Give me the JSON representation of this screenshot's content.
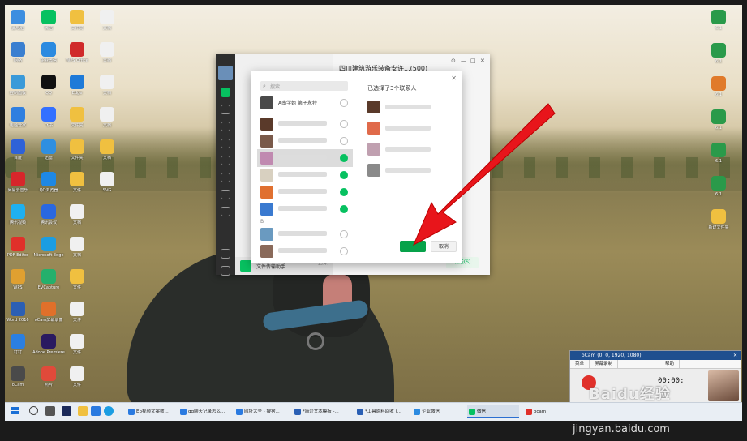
{
  "desktop": {
    "left_col1": [
      {
        "label": "此电脑",
        "color": "#3d8ee0"
      },
      {
        "label": "网络",
        "color": "#3a7fd0"
      },
      {
        "label": "控制面板",
        "color": "#3a9ad9"
      },
      {
        "label": "电脑管家",
        "color": "#2f7fe0"
      },
      {
        "label": "百度",
        "color": "#2f62d8"
      },
      {
        "label": "网易云音乐",
        "color": "#d7262b"
      },
      {
        "label": "腾讯视频",
        "color": "#1fb0f0"
      },
      {
        "label": "PDF Editor",
        "color": "#e0302a"
      },
      {
        "label": "WPS",
        "color": "#e0a030"
      },
      {
        "label": "Word 2016",
        "color": "#2b5fb4"
      },
      {
        "label": "钉钉",
        "color": "#2b7fe0"
      },
      {
        "label": "oCam",
        "color": "#4a4a4a"
      }
    ],
    "left_col2": [
      {
        "label": "微信",
        "color": "#07c160"
      },
      {
        "label": "企业微信",
        "color": "#2b8ae0"
      },
      {
        "label": "QQ",
        "color": "#111111"
      },
      {
        "label": "飞书",
        "color": "#3370ff"
      },
      {
        "label": "迅雷",
        "color": "#2f8fe0"
      },
      {
        "label": "QQ浏览器",
        "color": "#1e88e5"
      },
      {
        "label": "腾讯会议",
        "color": "#2a68e0"
      },
      {
        "label": "Microsoft Edge",
        "color": "#1b9de2"
      },
      {
        "label": "EVCapture",
        "color": "#25b06c"
      },
      {
        "label": "oCam屏幕录像",
        "color": "#e0702a"
      },
      {
        "label": "Adobe Premiere",
        "color": "#2a1a60"
      },
      {
        "label": "照片",
        "color": "#e04a3a"
      }
    ],
    "left_col3": [
      {
        "label": "文件夹",
        "color": "#f0c040"
      },
      {
        "label": "WPS Office",
        "color": "#d02a2a"
      },
      {
        "label": "Edge",
        "color": "#1e7ad8"
      },
      {
        "label": "文件夹",
        "color": "#f0c040"
      },
      {
        "label": "文件夹",
        "color": "#f0c040"
      },
      {
        "label": "文件",
        "color": "#f0c040"
      },
      {
        "label": "文档",
        "color": "#f0f0f0"
      },
      {
        "label": "文档",
        "color": "#f0f0f0"
      },
      {
        "label": "文件",
        "color": "#f0c040"
      },
      {
        "label": "文件",
        "color": "#f0f0f0"
      },
      {
        "label": "文件",
        "color": "#f0f0f0"
      },
      {
        "label": "文件",
        "color": "#f0f0f0"
      }
    ],
    "left_col4": [
      {
        "label": "文档",
        "color": "#f0f0f0"
      },
      {
        "label": "文档",
        "color": "#f0f0f0"
      },
      {
        "label": "文档",
        "color": "#f0f0f0"
      },
      {
        "label": "文档",
        "color": "#f0f0f0"
      },
      {
        "label": "文档",
        "color": "#f0c040"
      },
      {
        "label": "SVG",
        "color": "#f0f0f0"
      }
    ],
    "right_col": [
      {
        "label": "6.1",
        "color": "#2a9a4a"
      },
      {
        "label": "6.1",
        "color": "#2a9a4a"
      },
      {
        "label": "6.1",
        "color": "#e07a2a"
      },
      {
        "label": "6.1",
        "color": "#2a9a4a"
      },
      {
        "label": "6.1",
        "color": "#2a9a4a"
      },
      {
        "label": "6.1",
        "color": "#2a9a4a"
      },
      {
        "label": "新建文件夹",
        "color": "#f0c040"
      }
    ]
  },
  "wechat": {
    "chat_title": "四川建筑游乐装备安许...(500)",
    "controls": [
      "⊙",
      "—",
      "□",
      "✕"
    ],
    "file_helper": "文件传输助手",
    "file_helper_time": "13:47",
    "send_label": "发送(S)"
  },
  "modal": {
    "search_placeholder": "搜索",
    "selected_text": "已选择了3个联系人",
    "close": "✕",
    "ok_label": "",
    "cancel_label": "取消",
    "first_contact": "A南学姐 第子永特",
    "section_letter": "B",
    "contacts": [
      {
        "color": "#5a3a2a",
        "checked": false
      },
      {
        "color": "#7a5a4a",
        "checked": false
      },
      {
        "color": "#c08ab0",
        "checked": true
      },
      {
        "color": "#d8d0c0",
        "checked": true
      },
      {
        "color": "#e07030",
        "checked": true
      },
      {
        "color": "#3a7ad0",
        "checked": true
      }
    ],
    "after_b": [
      {
        "color": "#6a9ac0",
        "checked": false
      },
      {
        "color": "#8a6a5a",
        "checked": false
      }
    ],
    "chips": [
      {
        "color": "#5a3a2a"
      },
      {
        "color": "#e06a4a"
      },
      {
        "color": "#c0a0b0"
      },
      {
        "color": "#8a8a8a"
      }
    ]
  },
  "ocam": {
    "title": "oCam (0, 0, 1920, 1080)",
    "close": "✕",
    "menu": [
      "菜单",
      "屏幕录制",
      "",
      "",
      "",
      "",
      "帮助"
    ],
    "time": "00:00:"
  },
  "watermark": {
    "brand": "Baidu经验",
    "url": "jingyan.baidu.com"
  },
  "taskbar": {
    "items": [
      {
        "label": "Ep视频文案数...",
        "color": "#2a7ae0",
        "active": false
      },
      {
        "label": "qq聊天记录怎么...",
        "color": "#2a7ae0",
        "active": false
      },
      {
        "label": "网址大全 - 搜狗...",
        "color": "#2a7ae0",
        "active": false
      },
      {
        "label": "*简介文本模板 -...",
        "color": "#2a5fb4",
        "active": false
      },
      {
        "label": "*工具原料回收 (...",
        "color": "#2a5fb4",
        "active": false
      },
      {
        "label": "企业微信",
        "color": "#2b8ae0",
        "active": false
      },
      {
        "label": "微信",
        "color": "#07c160",
        "active": true
      },
      {
        "label": "ocam",
        "color": "#e0302a",
        "active": false
      }
    ]
  }
}
